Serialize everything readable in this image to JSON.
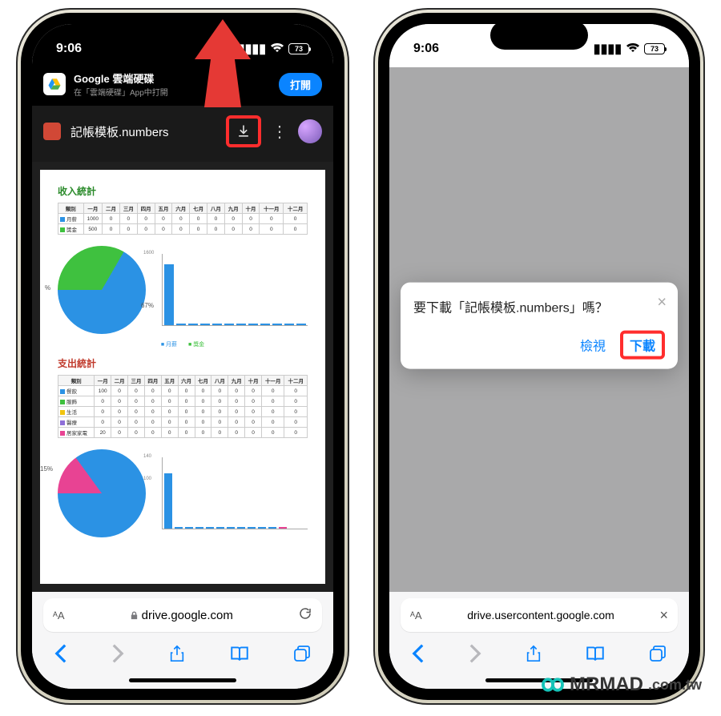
{
  "status": {
    "time": "9:06",
    "battery": "73"
  },
  "phone1": {
    "banner": {
      "title": "Google 雲端硬碟",
      "sub": "在「雲端硬碟」App中打開",
      "open": "打開"
    },
    "file": {
      "name": "記帳模板.numbers"
    },
    "doc": {
      "income_title": "收入統計",
      "expense_title": "支出統計",
      "months": [
        "類別",
        "一月",
        "二月",
        "三月",
        "四月",
        "五月",
        "六月",
        "七月",
        "八月",
        "九月",
        "十月",
        "十一月",
        "十二月"
      ],
      "income_rows": [
        {
          "label": "月薪",
          "vals": [
            1000,
            0,
            0,
            0,
            0,
            0,
            0,
            0,
            0,
            0,
            0,
            0
          ],
          "color": "#2b92e4"
        },
        {
          "label": "獎金",
          "vals": [
            500,
            0,
            0,
            0,
            0,
            0,
            0,
            0,
            0,
            0,
            0,
            0
          ],
          "color": "#3fc13f"
        }
      ],
      "expense_rows": [
        {
          "label": "餐飲",
          "vals": [
            100,
            0,
            0,
            0,
            0,
            0,
            0,
            0,
            0,
            0,
            0,
            0
          ],
          "color": "#2b92e4"
        },
        {
          "label": "服飾",
          "vals": [
            0,
            0,
            0,
            0,
            0,
            0,
            0,
            0,
            0,
            0,
            0,
            0
          ],
          "color": "#3fc13f"
        },
        {
          "label": "生活",
          "vals": [
            0,
            0,
            0,
            0,
            0,
            0,
            0,
            0,
            0,
            0,
            0,
            0
          ],
          "color": "#f1c40f"
        },
        {
          "label": "醫療",
          "vals": [
            0,
            0,
            0,
            0,
            0,
            0,
            0,
            0,
            0,
            0,
            0,
            0
          ],
          "color": "#8e6fd8"
        },
        {
          "label": "居家家電",
          "vals": [
            20,
            0,
            0,
            0,
            0,
            0,
            0,
            0,
            0,
            0,
            0,
            0
          ],
          "color": "#e84393"
        }
      ],
      "income_pie": {
        "pct": "67%",
        "sym": "%",
        "slices": [
          {
            "c": "#3fc13f",
            "deg": 120
          },
          {
            "c": "#2b92e4",
            "deg": 240
          }
        ]
      },
      "expense_pie": {
        "pct": "15%",
        "slices": [
          {
            "c": "#e84393",
            "deg": 54
          },
          {
            "c": "#2b92e4",
            "deg": 306
          }
        ]
      },
      "income_bar_max": "1600",
      "expense_bar_max": "140",
      "expense_bar_mid": "100",
      "legend": [
        "月薪",
        "獎金"
      ]
    },
    "url": {
      "host": "drive.google.com"
    }
  },
  "phone2": {
    "dialog": {
      "title": "要下載「記帳模板.numbers」嗎？",
      "view": "檢視",
      "download": "下載"
    },
    "url": {
      "host": "drive.usercontent.google.com"
    }
  },
  "watermark": {
    "brand": "MRMAD",
    "suffix": ".com.tw"
  }
}
